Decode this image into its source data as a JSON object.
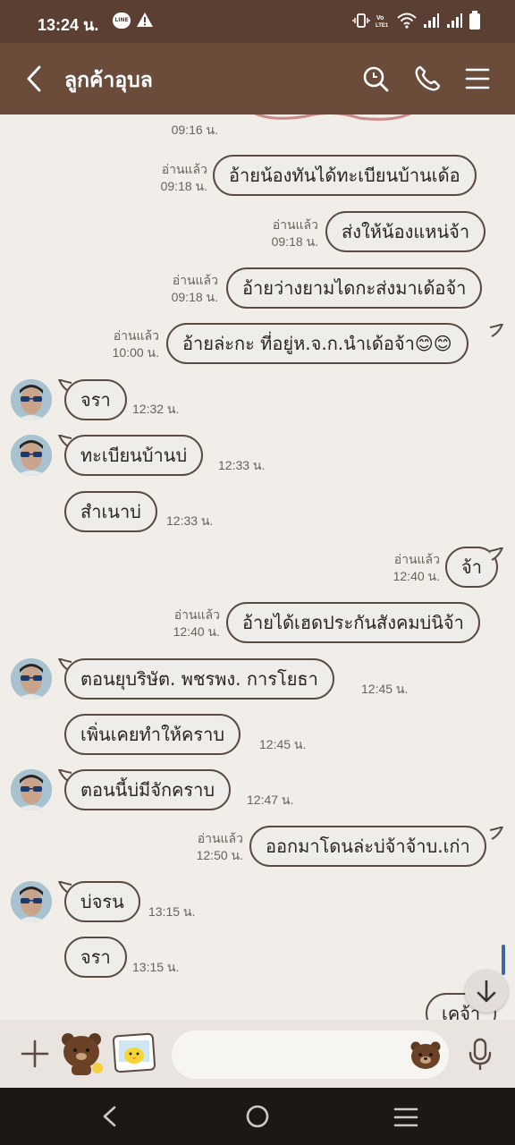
{
  "status_bar": {
    "time": "13:24 น."
  },
  "header": {
    "title": "ลูกค้าอุบล",
    "icons": [
      "back-arrow-icon",
      "search-icon",
      "phone-icon",
      "menu-icon"
    ]
  },
  "messages": [
    {
      "side": "right",
      "read": "",
      "time": "09:16 น.",
      "text": ""
    },
    {
      "side": "right",
      "read": "อ่านแล้ว",
      "time": "09:18 น.",
      "text": "อ้ายน้องทันได้ทะเบียนบ้านเด้อ"
    },
    {
      "side": "right",
      "read": "อ่านแล้ว",
      "time": "09:18 น.",
      "text": "ส่งให้น้องแหน่จ้า"
    },
    {
      "side": "right",
      "read": "อ่านแล้ว",
      "time": "09:18 น.",
      "text": "อ้ายว่างยามไดกะส่งมาเด้อจ้า"
    },
    {
      "side": "right",
      "read": "อ่านแล้ว",
      "time": "10:00 น.",
      "text": "อ้ายล่ะกะ ที่อยู่ห.จ.ก.นำเด้อจ้า😊😊"
    },
    {
      "side": "left",
      "time": "12:32 น.",
      "text": "จรา"
    },
    {
      "side": "left",
      "time": "12:33 น.",
      "text": "ทะเบียนบ้านบ่"
    },
    {
      "side": "left",
      "time": "12:33 น.",
      "text": "สำเนาบ่"
    },
    {
      "side": "right",
      "read": "อ่านแล้ว",
      "time": "12:40 น.",
      "text": "จ้า"
    },
    {
      "side": "right",
      "read": "อ่านแล้ว",
      "time": "12:40 น.",
      "text": "อ้ายได้เฮดประกันสังคมบ่นิจ้า"
    },
    {
      "side": "left",
      "time": "12:45 น.",
      "text": "ตอนยุบริษัต. พชรพง.  การโยธา"
    },
    {
      "side": "left",
      "time": "12:45 น.",
      "text": "เพิ่นเคยทำให้คราบ"
    },
    {
      "side": "left",
      "time": "12:47 น.",
      "text": "ตอนนี้บ่มีจักคราบ"
    },
    {
      "side": "right",
      "read": "อ่านแล้ว",
      "time": "12:50 น.",
      "text": "ออกมาโดนล่ะบ่จ้าจ้าบ.เก่า"
    },
    {
      "side": "left",
      "time": "13:15 น.",
      "text": "บ่จรน"
    },
    {
      "side": "left",
      "time": "13:15 น.",
      "text": "จรา"
    },
    {
      "side": "right",
      "read": "",
      "time": "",
      "text": "เคจ้า"
    }
  ],
  "input": {
    "placeholder": ""
  },
  "colors": {
    "header": "#6b4c3b",
    "status_bar": "#5a3f32",
    "chat_bg": "#f1ede8",
    "bubble_border": "#5a4a42"
  }
}
